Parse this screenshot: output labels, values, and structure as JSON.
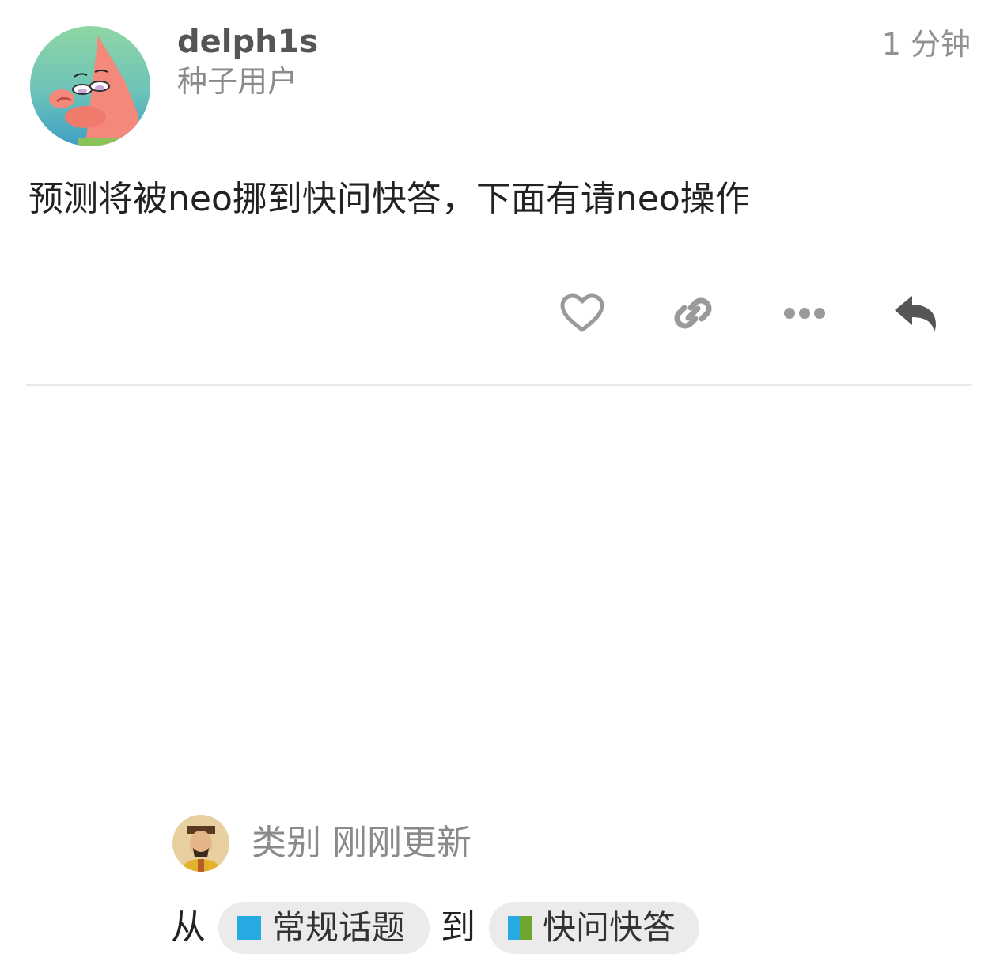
{
  "post": {
    "username": "delph1s",
    "user_title": "种子用户",
    "time": "1 分钟",
    "body": "预测将被neo挪到快问快答，下面有请neo操作",
    "actions": [
      {
        "name": "like-icon"
      },
      {
        "name": "link-icon"
      },
      {
        "name": "more-icon"
      },
      {
        "name": "reply-icon"
      }
    ]
  },
  "small_action": {
    "description": "类别 刚刚更新",
    "from_label": "从",
    "to_label": "到",
    "from_category": {
      "name": "常规话题",
      "colors": [
        "#25AAE2"
      ]
    },
    "to_category": {
      "name": "快问快答",
      "colors": [
        "#25AAE2",
        "#6DA52F"
      ]
    }
  },
  "colors": {
    "icon_gray": "#9a9a9a",
    "reply_icon": "#555555",
    "badge_bg": "#ebebeb"
  }
}
